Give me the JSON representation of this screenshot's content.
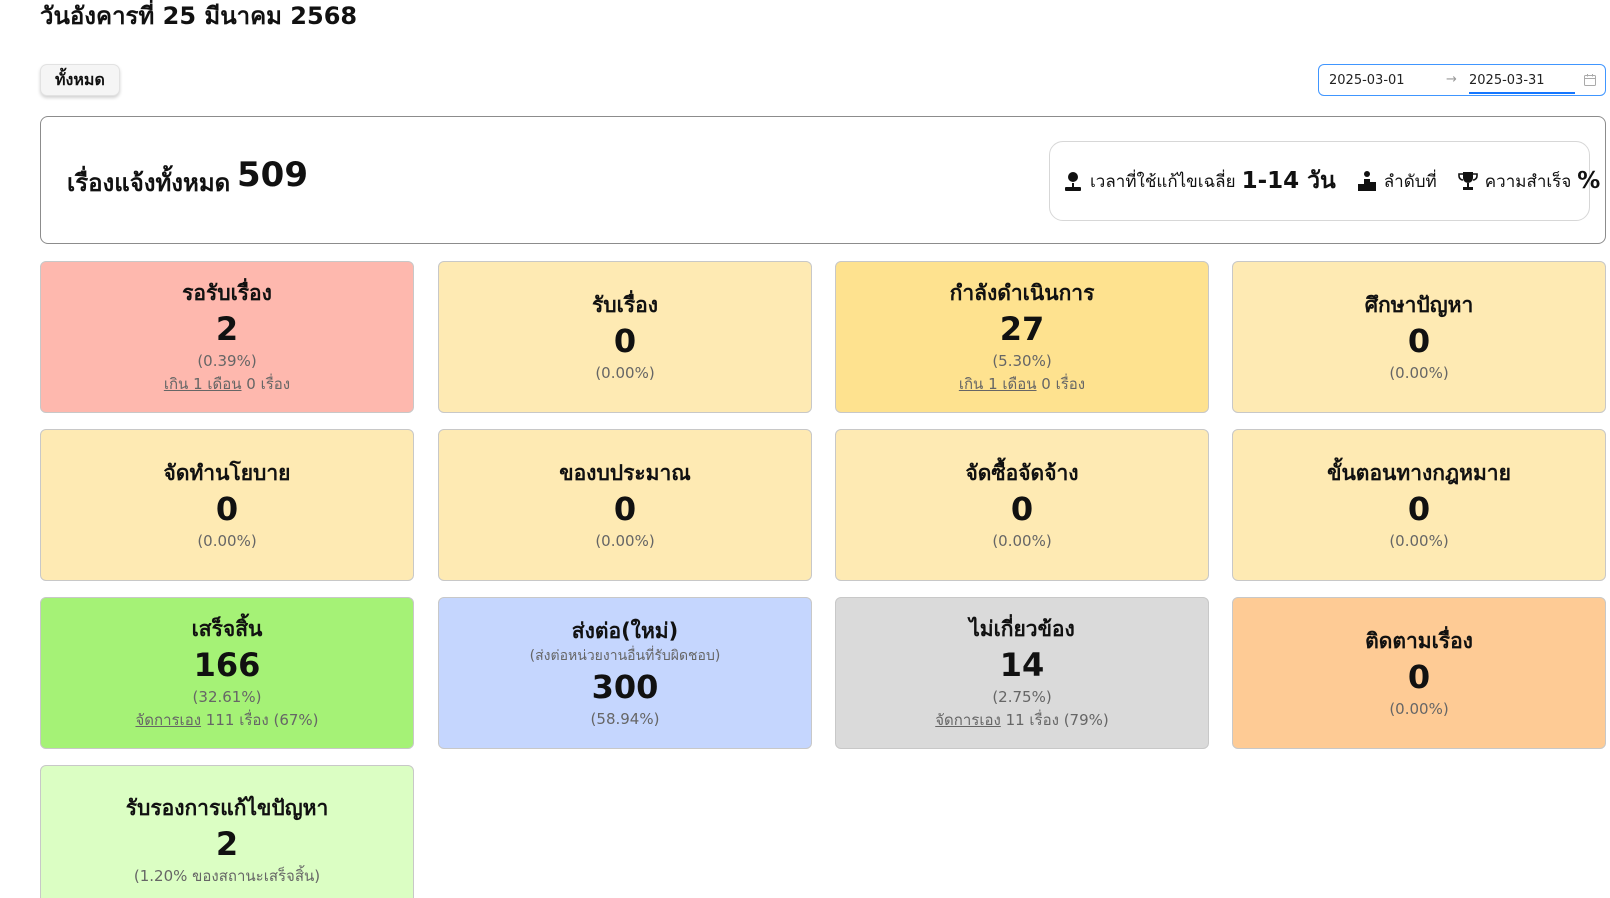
{
  "header": {
    "date": "วันอังคารที่ 25 มีนาคม 2568"
  },
  "filter": {
    "all_label": "ทั้งหมด"
  },
  "date_range": {
    "start": "2025-03-01",
    "arrow": "→",
    "end": "2025-03-31"
  },
  "summary": {
    "label": "เรื่องแจ้งทั้งหมด",
    "total": "509",
    "avg_time_label": "เวลาที่ใช้แก้ไขเฉลี่ย",
    "avg_time_value": "1-14 วัน",
    "rank_label": "ลำดับที่",
    "success_label": "ความสำเร็จ",
    "success_value": "%"
  },
  "cards": [
    {
      "title": "รอรับเรื่อง",
      "value": "2",
      "percent": "(0.39%)",
      "over_link": "เกิน 1 เดือน",
      "over_text": " 0 เรื่อง",
      "color": "#feb8ae"
    },
    {
      "title": "รับเรื่อง",
      "value": "0",
      "percent": "(0.00%)",
      "color": "#feeab3"
    },
    {
      "title": "กำลังดำเนินการ",
      "value": "27",
      "percent": "(5.30%)",
      "over_link": "เกิน 1 เดือน",
      "over_text": " 0 เรื่อง",
      "color": "#fee28f"
    },
    {
      "title": "ศึกษาปัญหา",
      "value": "0",
      "percent": "(0.00%)",
      "color": "#feeab3"
    },
    {
      "title": "จัดทำนโยบาย",
      "value": "0",
      "percent": "(0.00%)",
      "color": "#feeab3"
    },
    {
      "title": "ของบประมาณ",
      "value": "0",
      "percent": "(0.00%)",
      "color": "#feeab3"
    },
    {
      "title": "จัดซื้อจัดจ้าง",
      "value": "0",
      "percent": "(0.00%)",
      "color": "#feeab3"
    },
    {
      "title": "ขั้นตอนทางกฎหมาย",
      "value": "0",
      "percent": "(0.00%)",
      "color": "#feeab3"
    },
    {
      "title": "เสร็จสิ้น",
      "value": "166",
      "percent": "(32.61%)",
      "self_link": "จัดการเอง",
      "self_text": " 111 เรื่อง (67%)",
      "color": "#a5f276"
    },
    {
      "title": "ส่งต่อ(ใหม่)",
      "subtitle": "(ส่งต่อหน่วยงานอื่นที่รับผิดชอบ)",
      "value": "300",
      "percent": "(58.94%)",
      "color": "#c5d6fe"
    },
    {
      "title": "ไม่เกี่ยวข้อง",
      "value": "14",
      "percent": "(2.75%)",
      "self_link": "จัดการเอง",
      "self_text": " 11 เรื่อง (79%)",
      "color": "#dadada"
    },
    {
      "title": "ติดตามเรื่อง",
      "value": "0",
      "percent": "(0.00%)",
      "color": "#fecb95"
    },
    {
      "title": "รับรองการแก้ไขปัญหา",
      "value": "2",
      "percent": "(1.20% ของสถานะเสร็จสิ้น)",
      "color": "#dbfec3"
    }
  ]
}
